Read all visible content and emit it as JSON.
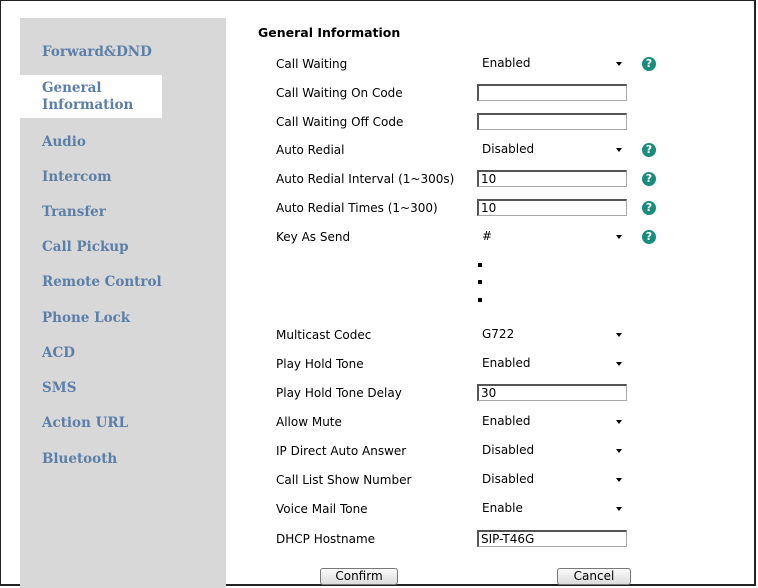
{
  "sidebar": {
    "items": [
      {
        "label": "Forward&DND"
      },
      {
        "label": "General\nInformation"
      },
      {
        "label": "Audio"
      },
      {
        "label": "Intercom"
      },
      {
        "label": "Transfer"
      },
      {
        "label": "Call Pickup"
      },
      {
        "label": "Remote Control"
      },
      {
        "label": "Phone Lock"
      },
      {
        "label": "ACD"
      },
      {
        "label": "SMS"
      },
      {
        "label": "Action URL"
      },
      {
        "label": "Bluetooth"
      }
    ]
  },
  "section": {
    "title": "General Information"
  },
  "rows": [
    {
      "label": "Call Waiting",
      "type": "select",
      "value": "Enabled",
      "help": true
    },
    {
      "label": "Call Waiting On Code",
      "type": "input",
      "value": "",
      "help": false
    },
    {
      "label": "Call Waiting Off Code",
      "type": "input",
      "value": "",
      "help": false
    },
    {
      "label": "Auto Redial",
      "type": "select",
      "value": "Disabled",
      "help": true
    },
    {
      "label": "Auto Redial Interval (1~300s)",
      "type": "input",
      "value": "10",
      "help": true
    },
    {
      "label": "Auto Redial Times (1~300)",
      "type": "input",
      "value": "10",
      "help": true
    },
    {
      "label": "Key As Send",
      "type": "select",
      "value": "#",
      "help": true
    },
    {
      "label": "Multicast Codec",
      "type": "select",
      "value": "G722",
      "help": false
    },
    {
      "label": "Play Hold Tone",
      "type": "select",
      "value": "Enabled",
      "help": false
    },
    {
      "label": "Play Hold Tone Delay",
      "type": "input",
      "value": "30",
      "help": false
    },
    {
      "label": "Allow Mute",
      "type": "select",
      "value": "Enabled",
      "help": false
    },
    {
      "label": "IP Direct Auto Answer",
      "type": "select",
      "value": "Disabled",
      "help": false
    },
    {
      "label": "Call List Show Number",
      "type": "select",
      "value": "Disabled",
      "help": false
    },
    {
      "label": "Voice Mail Tone",
      "type": "select",
      "value": "Enable",
      "help": false
    },
    {
      "label": "DHCP Hostname",
      "type": "input",
      "value": "SIP-T46G",
      "help": false
    }
  ],
  "help_icon": {
    "glyph": "?",
    "color": "#1a8c7c"
  },
  "buttons": {
    "confirm": "Confirm",
    "cancel": "Cancel"
  }
}
